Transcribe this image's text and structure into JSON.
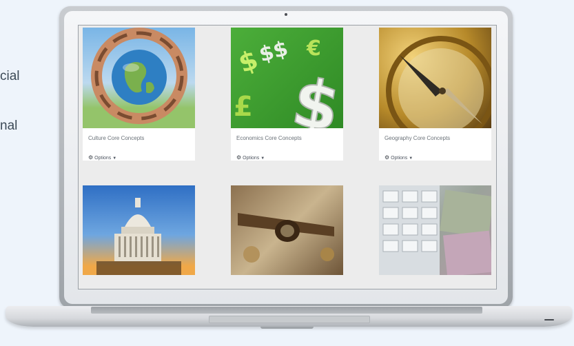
{
  "side_text": [
    "cial",
    "nal"
  ],
  "tiles": [
    {
      "title": "Culture Core Concepts",
      "options_label": "Options",
      "image": "globe-in-hands"
    },
    {
      "title": "Economics Core Concepts",
      "options_label": "Options",
      "image": "currency-symbols"
    },
    {
      "title": "Geography Core Concepts",
      "options_label": "Options",
      "image": "compass"
    },
    {
      "title": "",
      "options_label": "",
      "image": "capitol-dome"
    },
    {
      "title": "",
      "options_label": "",
      "image": "telescope-and-map"
    },
    {
      "title": "",
      "options_label": "",
      "image": "calculator-and-money"
    }
  ]
}
